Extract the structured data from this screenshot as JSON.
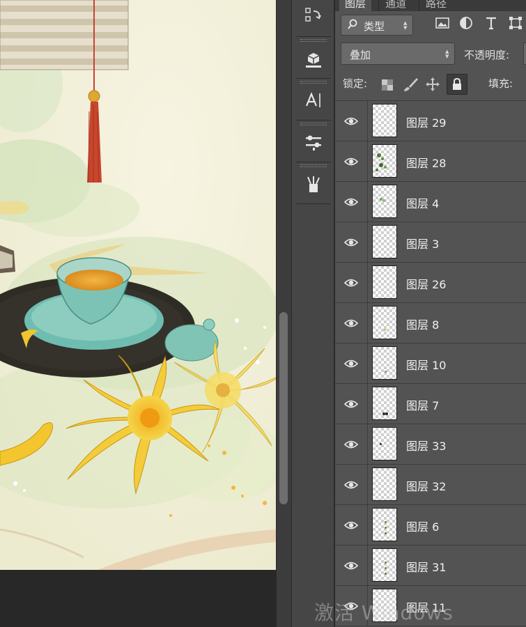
{
  "colors": {
    "panel_bg": "#535353",
    "dark_bg": "#282828",
    "toolstrip_bg": "#464646",
    "text": "#f0f0f0",
    "paper": "#f3f0da"
  },
  "panel": {
    "tabs": [
      "图层",
      "通道",
      "路径"
    ],
    "filter": {
      "label": "类型",
      "icon": "magnifier-icon"
    },
    "filter_icons": [
      "image-filter-icon",
      "adjustment-filter-icon",
      "type-filter-icon",
      "shape-filter-icon"
    ],
    "blend_mode": "叠加",
    "opacity_label": "不透明度:",
    "lock_label": "锁定:",
    "fill_label": "填充:",
    "lock_icons": [
      "lock-transparent-icon",
      "lock-brush-icon",
      "lock-move-icon",
      "lock-all-icon"
    ]
  },
  "tools": [
    "history-icon",
    "3d-icon",
    "character-icon",
    "adjust-icon",
    "brush-presets-icon"
  ],
  "layers": [
    {
      "name": "图层 29",
      "visible": true,
      "thumb": "empty"
    },
    {
      "name": "图层 28",
      "visible": true,
      "thumb": "green-leaves"
    },
    {
      "name": "图层 4",
      "visible": true,
      "thumb": "green-small"
    },
    {
      "name": "图层 3",
      "visible": true,
      "thumb": "empty"
    },
    {
      "name": "图层 26",
      "visible": true,
      "thumb": "empty"
    },
    {
      "name": "图层 8",
      "visible": true,
      "thumb": "tiny-yellow"
    },
    {
      "name": "图层 10",
      "visible": true,
      "thumb": "tiny-green"
    },
    {
      "name": "图层 7",
      "visible": true,
      "thumb": "dark-mark"
    },
    {
      "name": "图层 33",
      "visible": true,
      "thumb": "dark-dot"
    },
    {
      "name": "图层 32",
      "visible": true,
      "thumb": "empty"
    },
    {
      "name": "图层 6",
      "visible": true,
      "thumb": "stem"
    },
    {
      "name": "图层 31",
      "visible": true,
      "thumb": "stem"
    },
    {
      "name": "图层 11",
      "visible": true,
      "thumb": "empty"
    }
  ],
  "watermark": "激活 Windows"
}
